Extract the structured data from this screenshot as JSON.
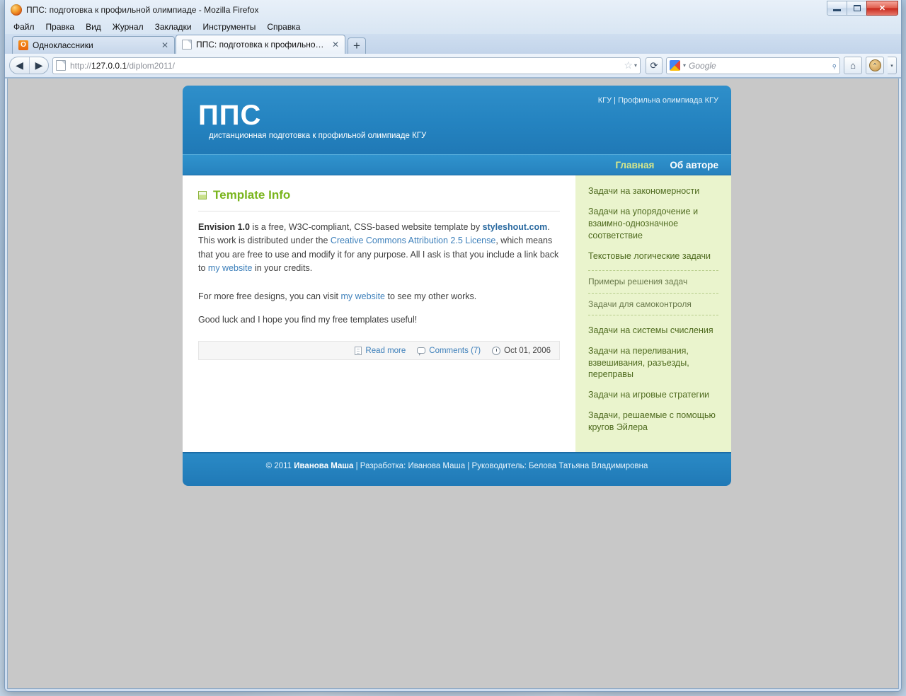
{
  "browser": {
    "window_title": "ППС: подготовка к профильной олимпиаде - Mozilla Firefox",
    "minimize_label": "Свернуть",
    "maximize_label": "Развернуть",
    "close_label": "✕",
    "menus": [
      "Файл",
      "Правка",
      "Вид",
      "Журнал",
      "Закладки",
      "Инструменты",
      "Справка"
    ],
    "tabs": [
      {
        "label": "Одноклассники",
        "favicon": "odnoklassniki-icon",
        "favicon_text": "ok",
        "active": false
      },
      {
        "label": "ППС: подготовка к профильной ол...",
        "favicon": "page-icon",
        "favicon_text": "",
        "active": true
      }
    ],
    "new_tab_label": "+",
    "tab_close_label": "✕",
    "back_label": "◀",
    "forward_label": "▶",
    "url_prefix": "http://",
    "url_host": "127.0.0.1",
    "url_path": "/diplom2011/",
    "bookmark_star": "☆",
    "reload_label": "⟳",
    "search_engine": "google-icon",
    "search_placeholder": "Google",
    "search_go": "⌕",
    "home_label": "⌂",
    "addon_label": "🐵",
    "overflow_caret": "▾"
  },
  "site": {
    "header": {
      "top_links": "КГУ | Профильна олимпиада КГУ",
      "logo": "ППС",
      "tagline": "дистанционная подготовка к профильной олимпиаде КГУ"
    },
    "nav": [
      {
        "label": "Главная",
        "current": true
      },
      {
        "label": "Об авторе",
        "current": false
      }
    ],
    "post": {
      "title": "Template Info",
      "p1_pre": "Envision 1.0",
      "p1_mid": " is a free, W3C-compliant, CSS-based website template by ",
      "p1_link1": "styleshout.com",
      "p1_after1": ". This work is distributed under the ",
      "p1_link2": "Creative Commons Attribution 2.5 License",
      "p1_after2": ", which means that you are free to use and modify it for any purpose. All I ask is that you include a link back to ",
      "p1_link3": "my website",
      "p1_after3": " in your credits.",
      "p2_pre": "For more free designs, you can visit ",
      "p2_link": "my website",
      "p2_post": " to see my other works.",
      "p3": "Good luck and I hope you find my free templates useful!",
      "meta": {
        "read_more": "Read more",
        "comments": "Comments (7)",
        "date": "Oct 01, 2006"
      }
    },
    "sidebar": {
      "main_items": [
        "Задачи на закономерности",
        "Задачи на упорядочение и взаимно-однозначное соответствие",
        "Текстовые логические задачи"
      ],
      "sub_items": [
        "Примеры решения задач",
        "Задачи для самоконтроля"
      ],
      "more_items": [
        "Задачи на системы счисления",
        "Задачи на переливания, взвешивания, разъезды, переправы",
        "Задачи на игровые стратегии",
        "Задачи, решаемые с помощью кругов Эйлера"
      ]
    },
    "footer": {
      "copyright": "© 2011 ",
      "author": "Иванова Маша",
      "sep1": " | Разработка: Иванова Маша | Руководитель: Белова Татьяна Владимировна"
    }
  },
  "colors": {
    "brand_blue": "#2483c0",
    "nav_current": "#d9e88a",
    "sidebar_bg": "#eaf4cd",
    "sidebar_link": "#4f6b1f",
    "heading_green": "#7ab51d",
    "link_blue": "#3c7fba"
  }
}
